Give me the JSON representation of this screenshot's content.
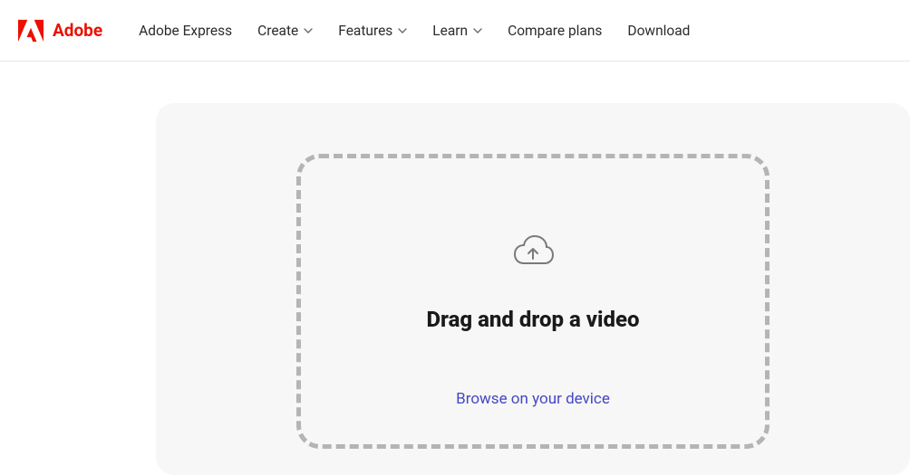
{
  "header": {
    "brand": "Adobe",
    "nav": {
      "express": "Adobe Express",
      "create": "Create",
      "features": "Features",
      "learn": "Learn",
      "compare": "Compare plans",
      "download": "Download"
    }
  },
  "dropzone": {
    "title": "Drag and drop a video",
    "browse": "Browse on your device"
  }
}
